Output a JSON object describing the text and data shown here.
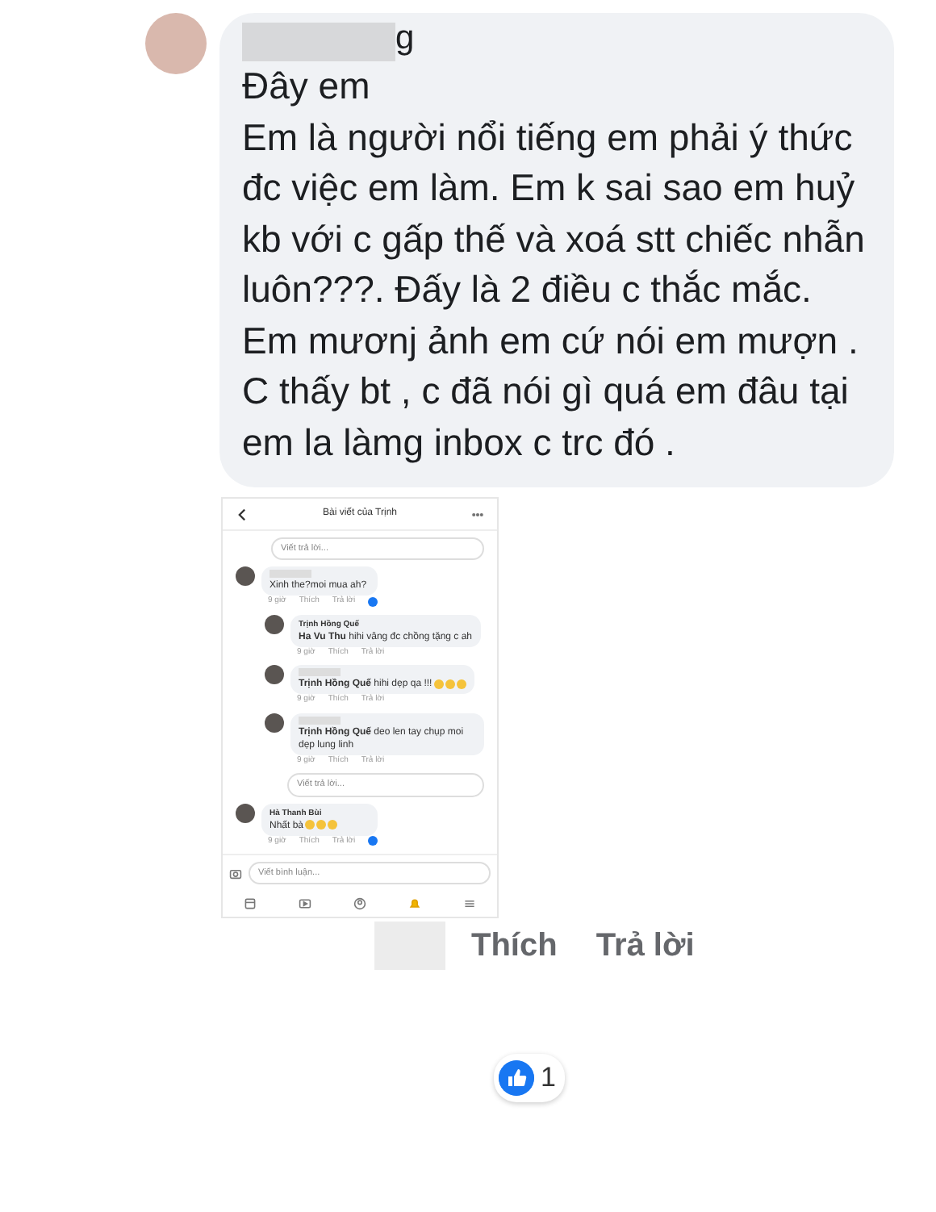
{
  "comment": {
    "author_visible": "g",
    "paragraphs": [
      "Đây em",
      "Em là người nổi tiếng em phải ý thức đc việc em làm. Em k sai sao em huỷ kb với c gấp thế và xoá stt chiếc nhẫn luôn???. Đấy là 2 điều c thắc mắc. Em mươnj  ảnh em cứ nói em mượn . C thấy bt , c đã nói gì quá em đâu tại em la làmg inbox c trc đó ."
    ]
  },
  "embedded_screenshot": {
    "header_title": "Bài viết của Trịnh",
    "top_reply_placeholder": "Viết trả lời...",
    "comments": [
      {
        "text": "Xinh the?moi mua ah?",
        "reacted": true,
        "time": "9 giờ",
        "like": "Thích",
        "reply": "Trả lời",
        "children": [
          {
            "author": "Trịnh Hồng Quế",
            "text": "**Ha Vu Thu** hihi vâng đc chồng tặng c ah",
            "time": "9 giờ",
            "like": "Thích",
            "reply": "Trả lời"
          },
          {
            "text": "**Trịnh Hồng Quế** hihi dẹp qa !!!",
            "has_emoji": true,
            "time": "9 giờ",
            "like": "Thích",
            "reply": "Trả lời"
          },
          {
            "text": "**Trịnh Hồng Quế** deo len tay chụp moi dẹp lung linh",
            "time": "9 giờ",
            "like": "Thích",
            "reply": "Trả lời"
          }
        ],
        "reply_placeholder": "Viết trả lời..."
      },
      {
        "author": "Hà Thanh Bùi",
        "text": "Nhất bà",
        "has_emoji": true,
        "reacted": true,
        "time": "9 giờ",
        "like": "Thích",
        "reply": "Trả lời"
      }
    ],
    "comment_placeholder": "Viết bình luận..."
  },
  "reaction_count": "1",
  "actions": [
    "Thích",
    "Trả lời"
  ]
}
